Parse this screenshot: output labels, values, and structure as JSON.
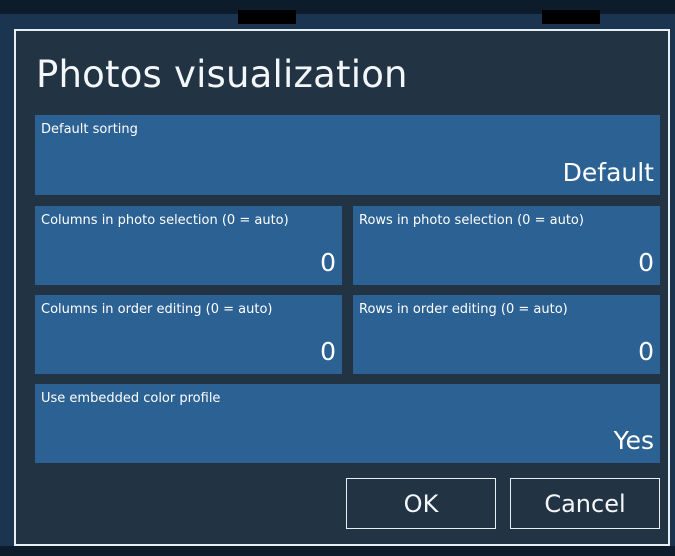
{
  "dialog": {
    "title": "Photos visualization",
    "fields": {
      "default_sorting": {
        "label": "Default sorting",
        "value": "Default"
      },
      "columns_photo_selection": {
        "label": "Columns in photo selection (0 = auto)",
        "value": "0"
      },
      "rows_photo_selection": {
        "label": "Rows in photo selection (0 = auto)",
        "value": "0"
      },
      "columns_order_editing": {
        "label": "Columns in order editing (0 = auto)",
        "value": "0"
      },
      "rows_order_editing": {
        "label": "Rows in order editing (0 = auto)",
        "value": "0"
      },
      "embedded_color_profile": {
        "label": "Use embedded color profile",
        "value": "Yes"
      }
    },
    "buttons": {
      "ok": "OK",
      "cancel": "Cancel"
    }
  },
  "colors": {
    "dialog_bg": "#223444",
    "field_bg": "#2c6193",
    "border": "#e9eef3",
    "text": "#ffffff"
  }
}
